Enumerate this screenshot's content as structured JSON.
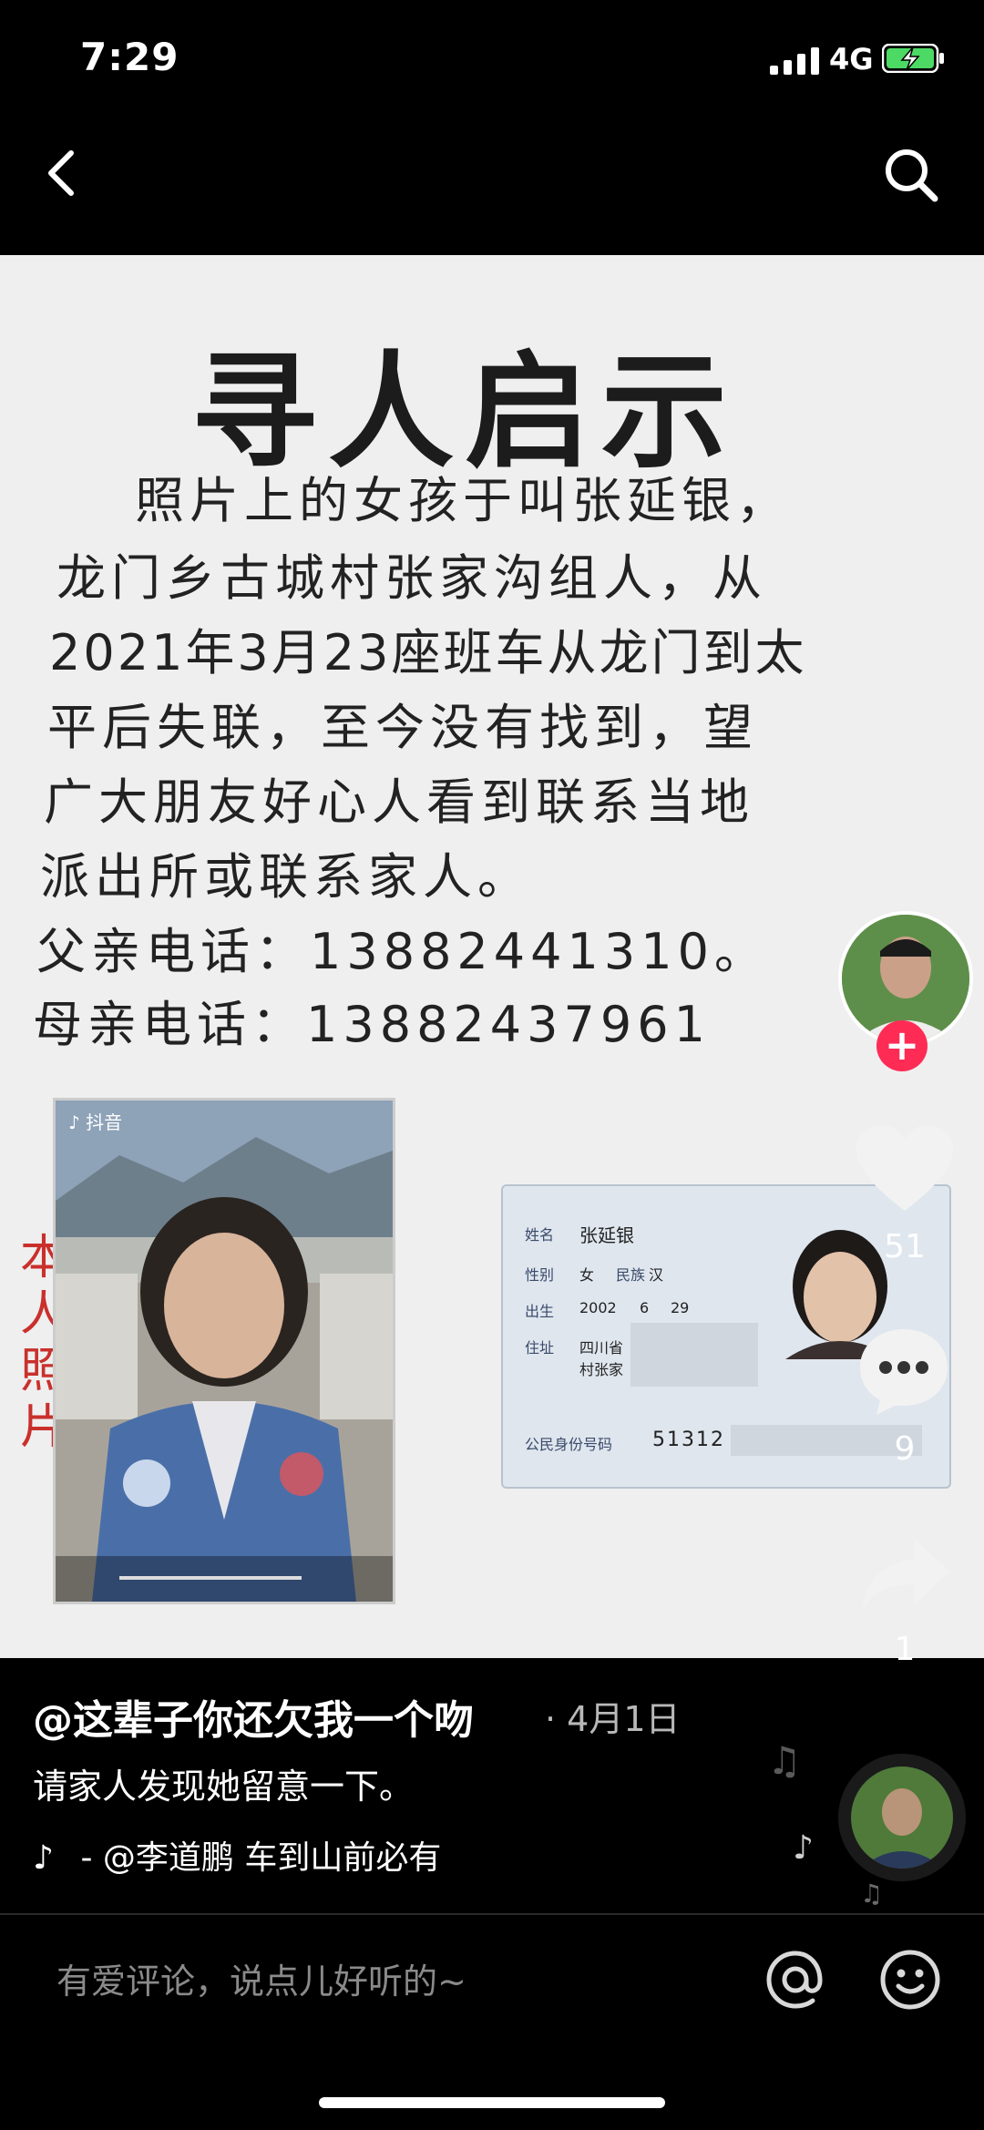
{
  "status_bar": {
    "time": "7:29",
    "network": "4G"
  },
  "poster": {
    "title": "寻人启示",
    "lines": [
      "照片上的女孩于叫张延银，",
      "龙门乡古城村张家沟组人，从",
      "2021年3月23座班车从龙门到太",
      "平后失联，至今没有找到，望",
      "广大朋友好心人看到联系当地",
      "派出所或联系家人。",
      "父亲电话：13882441310。",
      "母亲电话：13882437961"
    ],
    "photo_label": "本人照片",
    "photo_watermark": "抖音",
    "id_card": {
      "name_label": "姓名",
      "name": "张延银",
      "sex_label": "性别",
      "sex": "女",
      "ethnicity_label": "民族",
      "ethnicity": "汉",
      "birth_label": "出生",
      "birth_year": "2002",
      "birth_month": "6",
      "birth_day": "29",
      "address_label": "住址",
      "address_1": "四川省",
      "address_2": "村张家",
      "id_label": "公民身份号码",
      "id_partial": "51312"
    }
  },
  "actions": {
    "likes": "51",
    "comments": "9",
    "shares": "1",
    "follow_symbol": "+"
  },
  "post": {
    "author": "@这辈子你还欠我一个吻",
    "date": "· 4月1日",
    "caption": "请家人发现她留意一下。",
    "music": "- @李道鹏     车到山前必有"
  },
  "comment_bar": {
    "placeholder": "有爱评论，说点儿好听的~"
  },
  "colors": {
    "accent": "#fe2c55",
    "stamp": "#c9302c"
  }
}
